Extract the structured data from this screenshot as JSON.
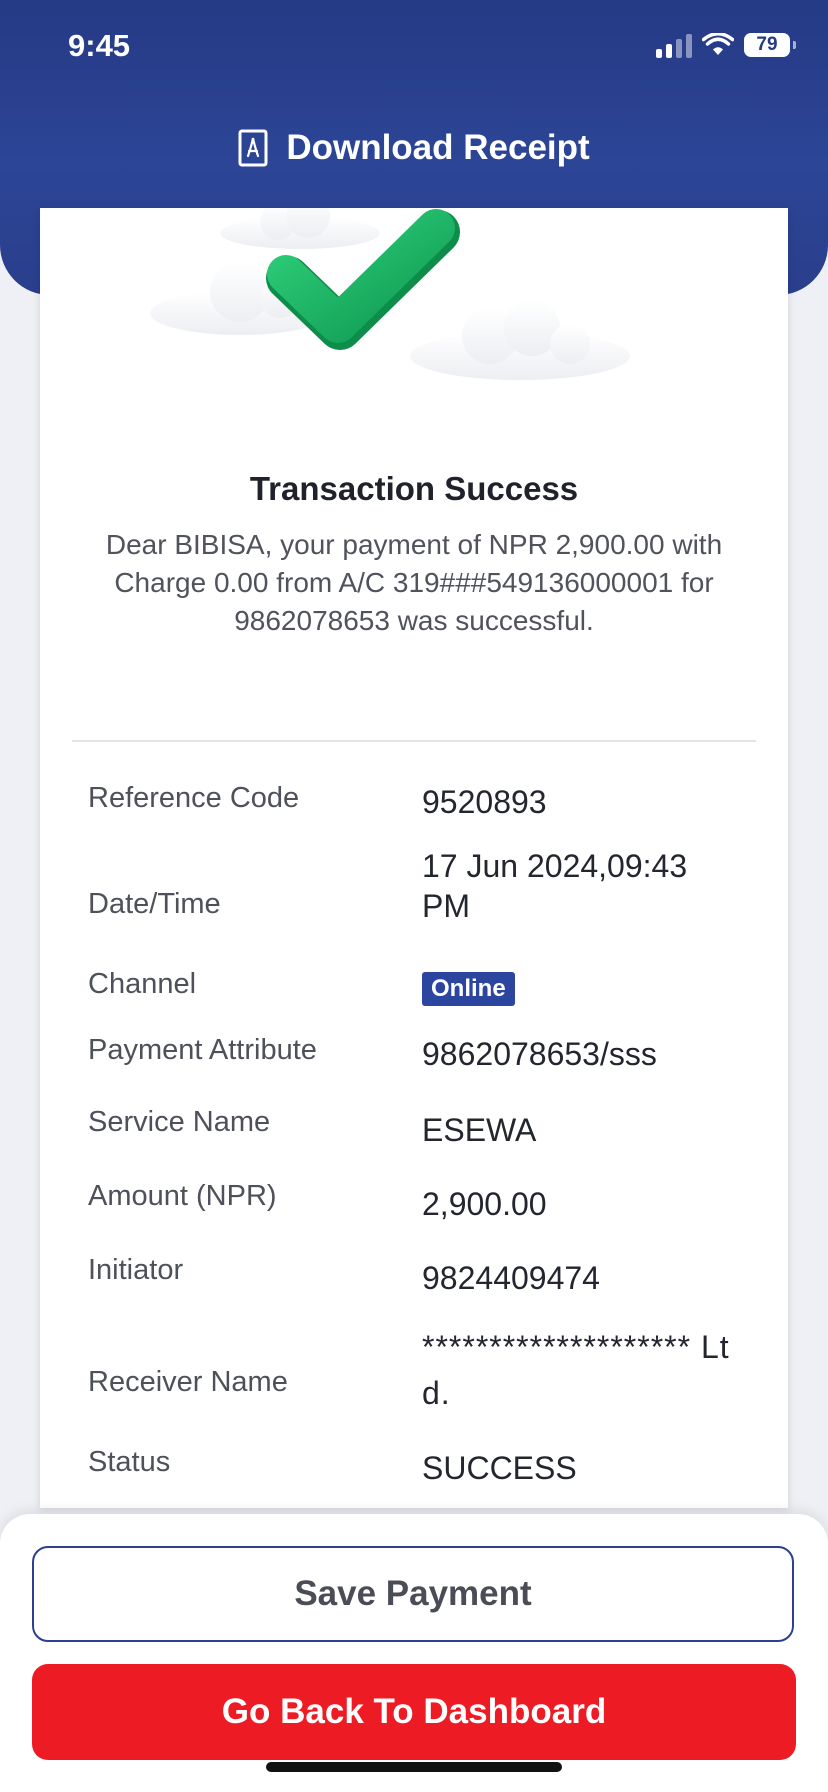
{
  "status_bar": {
    "time": "9:45",
    "battery": "79"
  },
  "header": {
    "download_label": "Download Receipt"
  },
  "receipt": {
    "title": "Transaction Success",
    "message": "Dear BIBISA, your payment of NPR 2,900.00 with Charge 0.00 from A/C 319###549136000001 for 9862078653 was successful.",
    "rows": [
      {
        "label": "Reference Code",
        "value": "9520893"
      },
      {
        "label": "Date/Time",
        "value": "17 Jun 2024,09:43 PM"
      },
      {
        "label": "Channel",
        "value": "Online"
      },
      {
        "label": "Payment Attribute",
        "value": "9862078653/sss"
      },
      {
        "label": "Service Name",
        "value": "ESEWA"
      },
      {
        "label": "Amount (NPR)",
        "value": "2,900.00"
      },
      {
        "label": "Initiator",
        "value": "9824409474"
      },
      {
        "label": "Receiver Name",
        "value": "******************** Ltd."
      },
      {
        "label": "Status",
        "value": "SUCCESS"
      }
    ]
  },
  "actions": {
    "save_label": "Save Payment",
    "dashboard_label": "Go Back To Dashboard"
  },
  "colors": {
    "primary": "#2c3f90",
    "danger": "#ed1c24",
    "success": "#22b866"
  }
}
